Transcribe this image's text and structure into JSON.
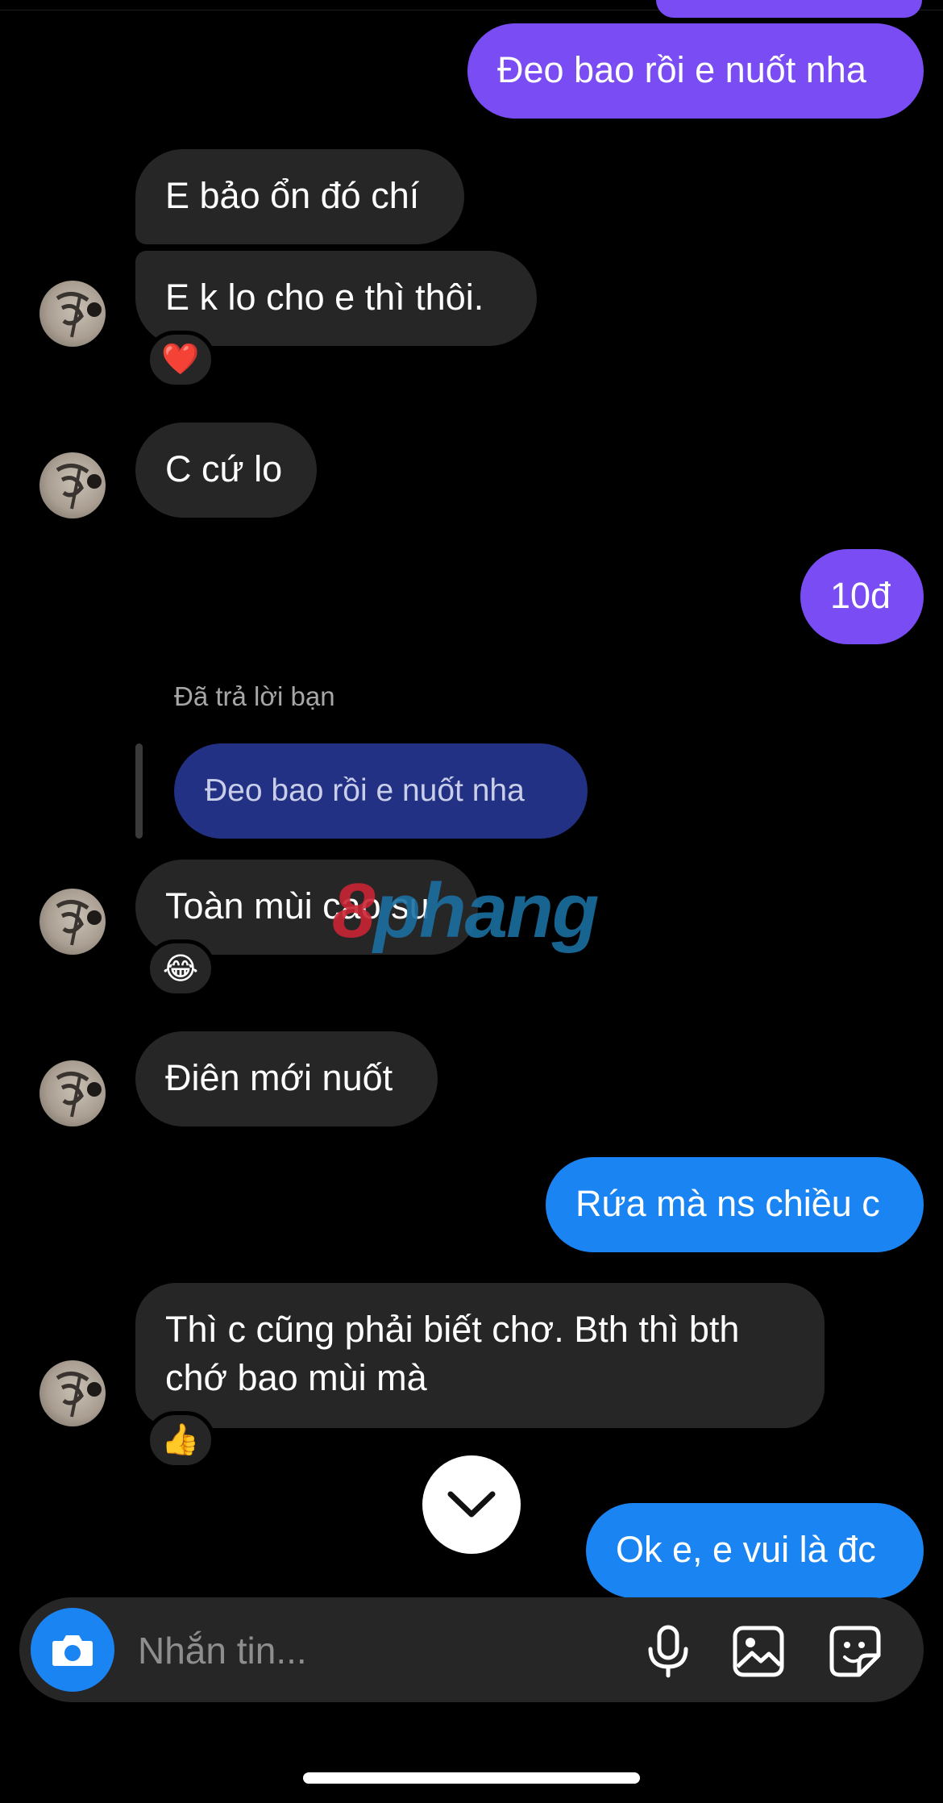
{
  "messages": [
    {
      "id": "m1",
      "side": "sent",
      "text": "Đeo bao rồi e nuốt nha"
    },
    {
      "id": "m2",
      "side": "received",
      "text": "E bảo ổn đó chí"
    },
    {
      "id": "m3",
      "side": "received",
      "text": "E k lo cho e thì thôi.",
      "reaction": "❤️"
    },
    {
      "id": "m4",
      "side": "received",
      "text": "C cứ lo"
    },
    {
      "id": "m5",
      "side": "sent",
      "text": "10đ"
    },
    {
      "id": "m6",
      "side": "received",
      "reply_label": "Đã trả lời bạn",
      "reply_quote": "Đeo bao rồi e nuốt nha",
      "text": "Toàn mùi cao su",
      "reaction": "😂"
    },
    {
      "id": "m7",
      "side": "received",
      "text": "Điên mới nuốt"
    },
    {
      "id": "m8",
      "side": "sent",
      "text": "Rứa mà ns chiều c"
    },
    {
      "id": "m9",
      "side": "received",
      "line1": "Thì c cũng phải biết chơ. Bth thì bth",
      "line2": "chớ bao mùi mà",
      "reaction": "👍"
    },
    {
      "id": "m10",
      "side": "sent",
      "text": "Ok e, e vui là đc"
    }
  ],
  "watermark": {
    "part1": "8",
    "part2": "phang"
  },
  "composer": {
    "placeholder": "Nhắn tin..."
  },
  "icons": {
    "camera": "camera-icon",
    "mic": "microphone-icon",
    "gallery": "gallery-icon",
    "sticker": "sticker-icon",
    "scroll": "chevron-down-icon"
  },
  "colors": {
    "sent_purple": "#7a4cf4",
    "sent_blue": "#1b84f3",
    "received": "#262626",
    "reply_quote": "#223184"
  }
}
